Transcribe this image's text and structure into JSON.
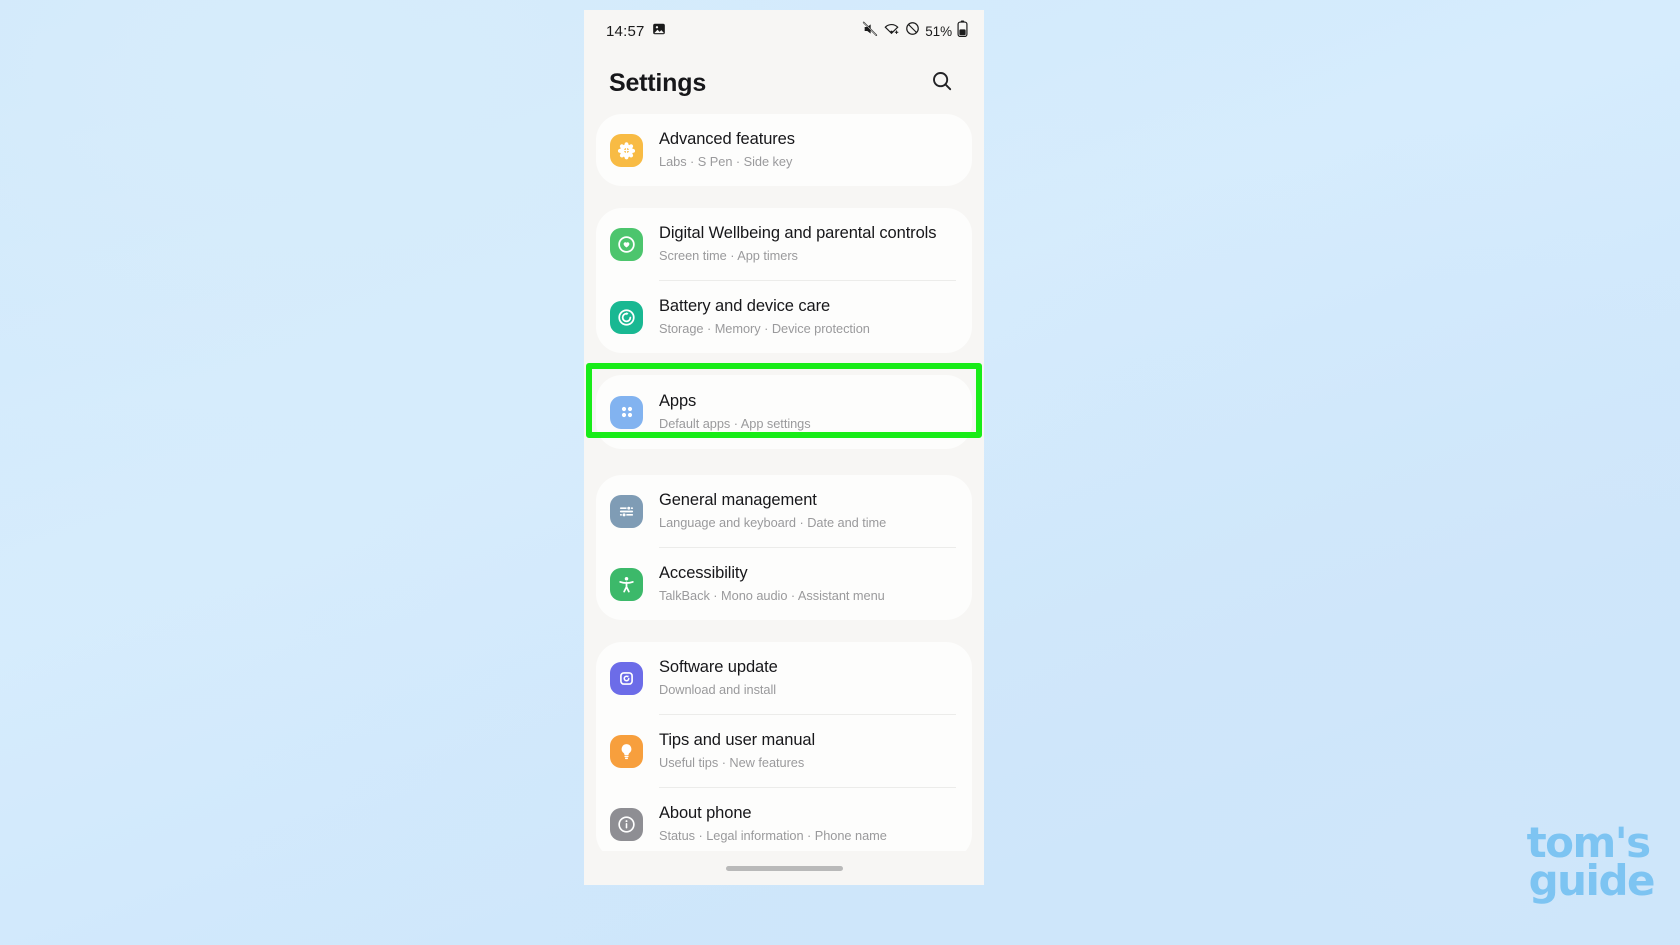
{
  "status_bar": {
    "clock": "14:57",
    "left_icons": [
      "screenshot-icon"
    ],
    "right_icons": [
      "mute-icon",
      "wifi-calling-icon",
      "dnd-icon"
    ],
    "battery_percent": "51%",
    "battery_icon": "battery-icon"
  },
  "header": {
    "title": "Settings",
    "search_icon": "search-icon"
  },
  "groups": [
    {
      "id": "group-advanced",
      "items": [
        {
          "id": "advanced-features",
          "title": "Advanced features",
          "subtitle": "Labs  ·  S Pen  ·  Side key",
          "icon": "advanced-features-icon",
          "icon_color": "#f8bb44"
        }
      ]
    },
    {
      "id": "group-wellbeing-battery",
      "items": [
        {
          "id": "digital-wellbeing",
          "title": "Digital Wellbeing and parental controls",
          "subtitle": "Screen time  ·  App timers",
          "icon": "digital-wellbeing-icon",
          "icon_color": "#4cc56d"
        },
        {
          "id": "battery-device-care",
          "title": "Battery and device care",
          "subtitle": "Storage  ·  Memory  ·  Device protection",
          "icon": "battery-device-care-icon",
          "icon_color": "#19b892"
        }
      ]
    },
    {
      "id": "group-apps",
      "highlighted": true,
      "items": [
        {
          "id": "apps",
          "title": "Apps",
          "subtitle": "Default apps  ·  App settings",
          "icon": "apps-icon",
          "icon_color": "#82b3f0"
        }
      ]
    },
    {
      "id": "group-general-accessibility",
      "items": [
        {
          "id": "general-management",
          "title": "General management",
          "subtitle": "Language and keyboard  ·  Date and time",
          "icon": "general-management-icon",
          "icon_color": "#7f9cb5"
        },
        {
          "id": "accessibility",
          "title": "Accessibility",
          "subtitle": "TalkBack  ·  Mono audio  ·  Assistant menu",
          "icon": "accessibility-icon",
          "icon_color": "#3cb96a"
        }
      ]
    },
    {
      "id": "group-update-tips-about",
      "items": [
        {
          "id": "software-update",
          "title": "Software update",
          "subtitle": "Download and install",
          "icon": "software-update-icon",
          "icon_color": "#6c6ce8"
        },
        {
          "id": "tips-user-manual",
          "title": "Tips and user manual",
          "subtitle": "Useful tips  ·  New features",
          "icon": "tips-icon",
          "icon_color": "#f79f3d"
        },
        {
          "id": "about-phone",
          "title": "About phone",
          "subtitle": "Status  ·  Legal information  ·  Phone name",
          "icon": "about-phone-icon",
          "icon_color": "#8e8e93"
        }
      ]
    }
  ],
  "highlight": {
    "color": "#18ec18",
    "target": "apps"
  },
  "watermark": {
    "line1": "tom's",
    "line2": "guide",
    "color": "#7dc4f2"
  }
}
